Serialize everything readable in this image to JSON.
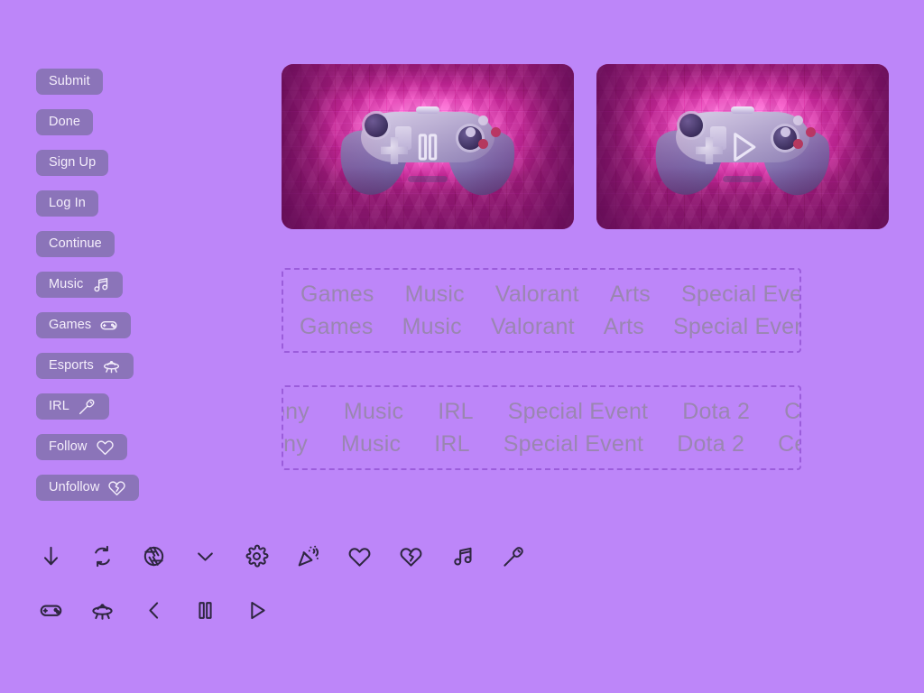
{
  "theme": {
    "background": "#bd86f9",
    "button_bg": "#8b74b9",
    "button_text": "#f4eefb",
    "tag_text": "#9a86b1",
    "dashed_border": "#9b5ddb",
    "icon_color": "#2e2640"
  },
  "sidebar": {
    "items": [
      {
        "label": "Submit",
        "icon": null
      },
      {
        "label": "Done",
        "icon": null
      },
      {
        "label": "Sign Up",
        "icon": null
      },
      {
        "label": "Log In",
        "icon": null
      },
      {
        "label": "Continue",
        "icon": null
      },
      {
        "label": "Music",
        "icon": "music-note-icon"
      },
      {
        "label": "Games",
        "icon": "gamepad-icon"
      },
      {
        "label": "Esports",
        "icon": "ufo-icon"
      },
      {
        "label": "IRL",
        "icon": "microphone-icon"
      },
      {
        "label": "Follow",
        "icon": "heart-icon"
      },
      {
        "label": "Unfollow",
        "icon": "broken-heart-icon"
      }
    ]
  },
  "thumbnails": [
    {
      "name": "video-thumbnail-paused",
      "overlay_icon": "pause-icon",
      "alt": "purple game controller in pink voxel tunnel"
    },
    {
      "name": "video-thumbnail-playing",
      "overlay_icon": "play-icon",
      "alt": "purple game controller in pink voxel tunnel"
    }
  ],
  "tag_groups": [
    {
      "name": "tag-group-categories",
      "rows": [
        [
          "Games",
          "Music",
          "Valorant",
          "Arts",
          "Special Event"
        ],
        [
          "Games",
          "Music",
          "Valorant",
          "Arts",
          "Special Event"
        ]
      ]
    },
    {
      "name": "tag-group-streams",
      "rows": [
        [
          "Ceremony",
          "Music",
          "IRL",
          "Special Event",
          "Dota 2",
          "Ceremony"
        ],
        [
          "Ceremony",
          "Music",
          "IRL",
          "Special Event",
          "Dota 2",
          "Ceremony"
        ]
      ]
    }
  ],
  "icon_strips": [
    {
      "name": "icon-strip-primary",
      "icons": [
        "arrow-down-icon",
        "refresh-icon",
        "aperture-icon",
        "chevron-down-icon",
        "gear-icon",
        "party-popper-icon",
        "heart-icon",
        "broken-heart-icon",
        "music-note-icon",
        "microphone-icon"
      ]
    },
    {
      "name": "icon-strip-secondary",
      "icons": [
        "gamepad-icon",
        "ufo-icon",
        "chevron-left-icon",
        "pause-icon",
        "play-icon"
      ]
    }
  ]
}
